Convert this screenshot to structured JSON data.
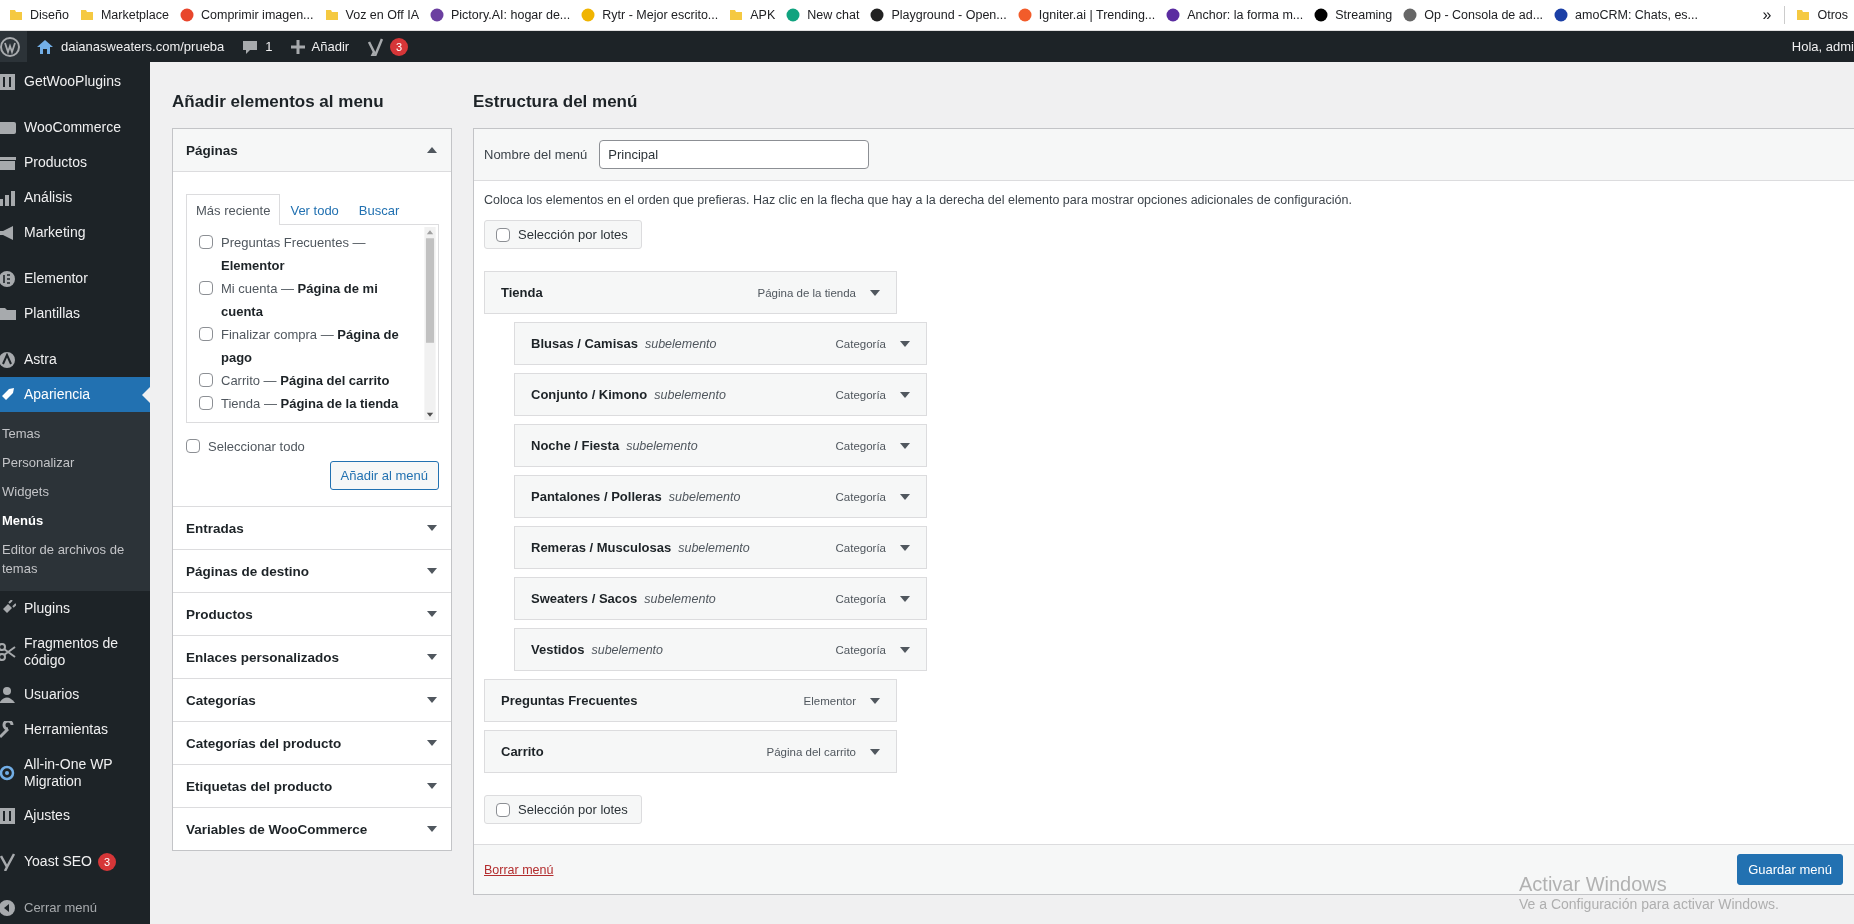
{
  "bookmarks": [
    {
      "label": "Diseño",
      "kind": "folder"
    },
    {
      "label": "Marketplace",
      "kind": "folder"
    },
    {
      "label": "Comprimir imagen...",
      "kind": "site"
    },
    {
      "label": "Voz en Off IA",
      "kind": "folder"
    },
    {
      "label": "Pictory.AI: hogar de...",
      "kind": "site"
    },
    {
      "label": "Rytr - Mejor escrito...",
      "kind": "site"
    },
    {
      "label": "APK",
      "kind": "folder"
    },
    {
      "label": "New chat",
      "kind": "site"
    },
    {
      "label": "Playground - Open...",
      "kind": "site"
    },
    {
      "label": "Igniter.ai | Trending...",
      "kind": "site"
    },
    {
      "label": "Anchor: la forma m...",
      "kind": "site"
    },
    {
      "label": "Streaming",
      "kind": "site"
    },
    {
      "label": "Op - Consola de ad...",
      "kind": "site"
    },
    {
      "label": "amoCRM: Chats, es...",
      "kind": "site"
    }
  ],
  "bookmarks_overflow": "»",
  "other_bookmarks": {
    "label": "Otros"
  },
  "admin_bar": {
    "site": "daianasweaters.com/prueba",
    "comments": "1",
    "new": "Añadir",
    "yoast_count": "3",
    "greeting": "Hola, admi"
  },
  "sidebar": {
    "groups": [
      [
        {
          "label": "GetWooPlugins",
          "selected": false
        }
      ],
      [
        {
          "label": "WooCommerce",
          "selected": false
        },
        {
          "label": "Productos",
          "selected": false
        },
        {
          "label": "Análisis",
          "selected": false
        },
        {
          "label": "Marketing",
          "selected": false
        }
      ],
      [
        {
          "label": "Elementor",
          "selected": false
        },
        {
          "label": "Plantillas",
          "selected": false
        }
      ],
      [
        {
          "label": "Astra",
          "selected": false
        },
        {
          "label": "Apariencia",
          "selected": true,
          "children": [
            {
              "label": "Temas",
              "selected": false
            },
            {
              "label": "Personalizar",
              "selected": false
            },
            {
              "label": "Widgets",
              "selected": false
            },
            {
              "label": "Menús",
              "selected": true
            },
            {
              "label": "Editor de archivos de temas",
              "selected": false
            }
          ]
        },
        {
          "label": "Plugins",
          "selected": false
        },
        {
          "label": "Fragmentos de código",
          "selected": false
        },
        {
          "label": "Usuarios",
          "selected": false
        },
        {
          "label": "Herramientas",
          "selected": false
        },
        {
          "label": "All-in-One WP Migration",
          "selected": false
        },
        {
          "label": "Ajustes",
          "selected": false
        }
      ],
      [
        {
          "label": "Yoast SEO",
          "selected": false,
          "badge": "3"
        }
      ]
    ],
    "collapse": "Cerrar menú"
  },
  "add_items": {
    "title": "Añadir elementos al menu",
    "sections": [
      {
        "label": "Páginas",
        "expanded": true,
        "tabs": [
          {
            "label": "Más reciente",
            "selected": true
          },
          {
            "label": "Ver todo",
            "selected": false
          },
          {
            "label": "Buscar",
            "selected": false
          }
        ],
        "pages": [
          {
            "label": "Preguntas Frecuentes — **Elementor**",
            "checked": false
          },
          {
            "label": "Mi cuenta — **Página de mi cuenta**",
            "checked": false
          },
          {
            "label": "Finalizar compra — **Página de pago**",
            "checked": false
          },
          {
            "label": "Carrito — **Página del carrito**",
            "checked": false
          },
          {
            "label": "Tienda — **Página de la tienda**",
            "checked": false
          }
        ],
        "select_all": {
          "label": "Seleccionar todo",
          "checked": false
        },
        "button": "Añadir al menú"
      },
      {
        "label": "Entradas",
        "expanded": false
      },
      {
        "label": "Páginas de destino",
        "expanded": false
      },
      {
        "label": "Productos",
        "expanded": false
      },
      {
        "label": "Enlaces personalizados",
        "expanded": false
      },
      {
        "label": "Categorías",
        "expanded": false
      },
      {
        "label": "Categorías del producto",
        "expanded": false
      },
      {
        "label": "Etiquetas del producto",
        "expanded": false
      },
      {
        "label": "Variables de WooCommerce",
        "expanded": false
      }
    ]
  },
  "structure": {
    "title": "Estructura del menú",
    "name_label": "Nombre del menú",
    "name_value": "Principal",
    "description": "Coloca los elementos en el orden que prefieras. Haz clic en la flecha que hay a la derecha del elemento para mostrar opciones adicionales de configuración.",
    "bulk_top": {
      "label": "Selección por lotes",
      "checked": false
    },
    "items": [
      {
        "title": "Tienda",
        "type": "Página de la tienda",
        "children": [
          {
            "title": "Blusas / Camisas",
            "note": "subelemento",
            "type": "Categoría"
          },
          {
            "title": "Conjunto / Kimono",
            "note": "subelemento",
            "type": "Categoría"
          },
          {
            "title": "Noche / Fiesta",
            "note": "subelemento",
            "type": "Categoría"
          },
          {
            "title": "Pantalones / Polleras",
            "note": "subelemento",
            "type": "Categoría"
          },
          {
            "title": "Remeras / Musculosas",
            "note": "subelemento",
            "type": "Categoría"
          },
          {
            "title": "Sweaters / Sacos",
            "note": "subelemento",
            "type": "Categoría"
          },
          {
            "title": "Vestidos",
            "note": "subelemento",
            "type": "Categoría"
          }
        ]
      },
      {
        "title": "Preguntas Frecuentes",
        "type": "Elementor"
      },
      {
        "title": "Carrito",
        "type": "Página del carrito"
      }
    ],
    "bulk_bottom": {
      "label": "Selección por lotes",
      "checked": false
    },
    "delete_link": "Borrar menú",
    "save_button": "Guardar menú"
  },
  "os_notice": {
    "title": "Activar Windows",
    "subtitle": "Ve a Configuración para activar Windows."
  }
}
